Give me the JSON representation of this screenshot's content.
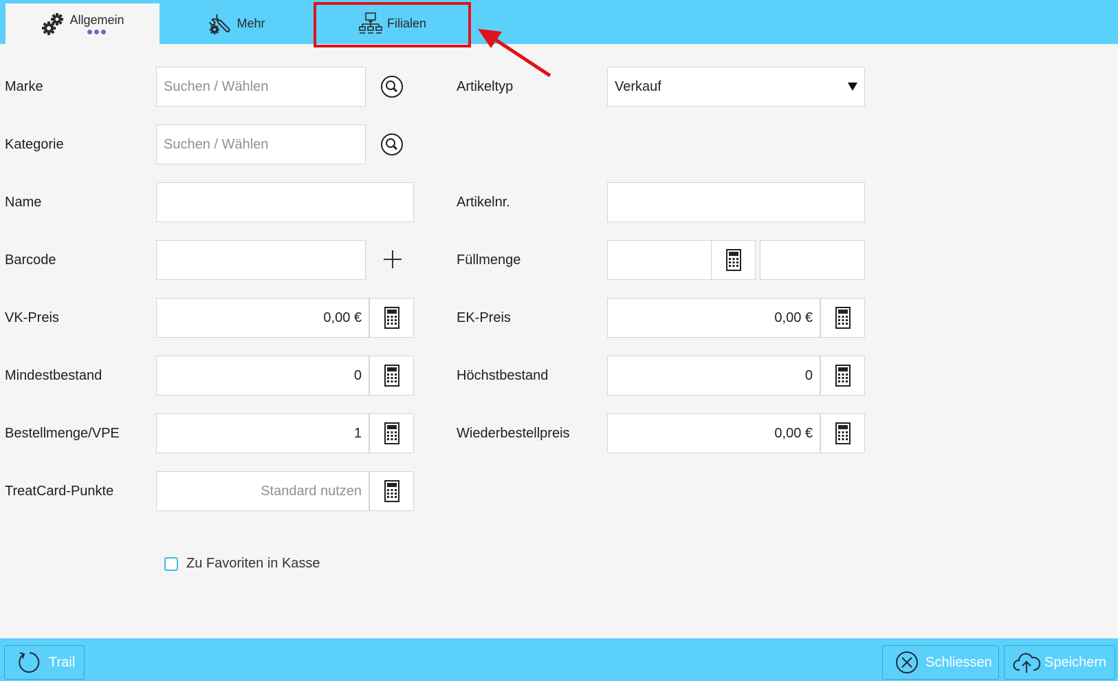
{
  "tabs": [
    {
      "label": "Allgemein",
      "icon": "gears-icon",
      "active": true
    },
    {
      "label": "Mehr",
      "icon": "wrench-gear-icon",
      "active": false
    },
    {
      "label": "Filialen",
      "icon": "network-icon",
      "active": false
    }
  ],
  "form": {
    "marke": {
      "label": "Marke",
      "placeholder": "Suchen / Wählen"
    },
    "kategorie": {
      "label": "Kategorie",
      "placeholder": "Suchen / Wählen"
    },
    "name": {
      "label": "Name",
      "value": ""
    },
    "barcode": {
      "label": "Barcode",
      "value": ""
    },
    "vk_preis": {
      "label": "VK-Preis",
      "value": "0,00 €"
    },
    "mindestbestand": {
      "label": "Mindestbestand",
      "value": "0"
    },
    "bestellmenge": {
      "label": "Bestellmenge/VPE",
      "value": "1"
    },
    "treatcard": {
      "label": "TreatCard-Punkte",
      "placeholder": "Standard nutzen"
    },
    "artikeltyp": {
      "label": "Artikeltyp",
      "value": "Verkauf"
    },
    "artikelnr": {
      "label": "Artikelnr.",
      "value": ""
    },
    "fuellmenge": {
      "label": "Füllmenge",
      "value": "",
      "unit": ""
    },
    "ek_preis": {
      "label": "EK-Preis",
      "value": "0,00 €"
    },
    "hoechstbestand": {
      "label": "Höchstbestand",
      "value": "0"
    },
    "wiederbestellpreis": {
      "label": "Wiederbestellpreis",
      "value": "0,00 €"
    },
    "favoriten": {
      "label": "Zu Favoriten in Kasse",
      "checked": false
    }
  },
  "footer": {
    "trail": "Trail",
    "schliessen": "Schliessen",
    "speichern": "Speichern"
  },
  "colors": {
    "accent": "#5bd0fb",
    "highlight": "#e0121b",
    "dots": "#8a5fb8"
  }
}
